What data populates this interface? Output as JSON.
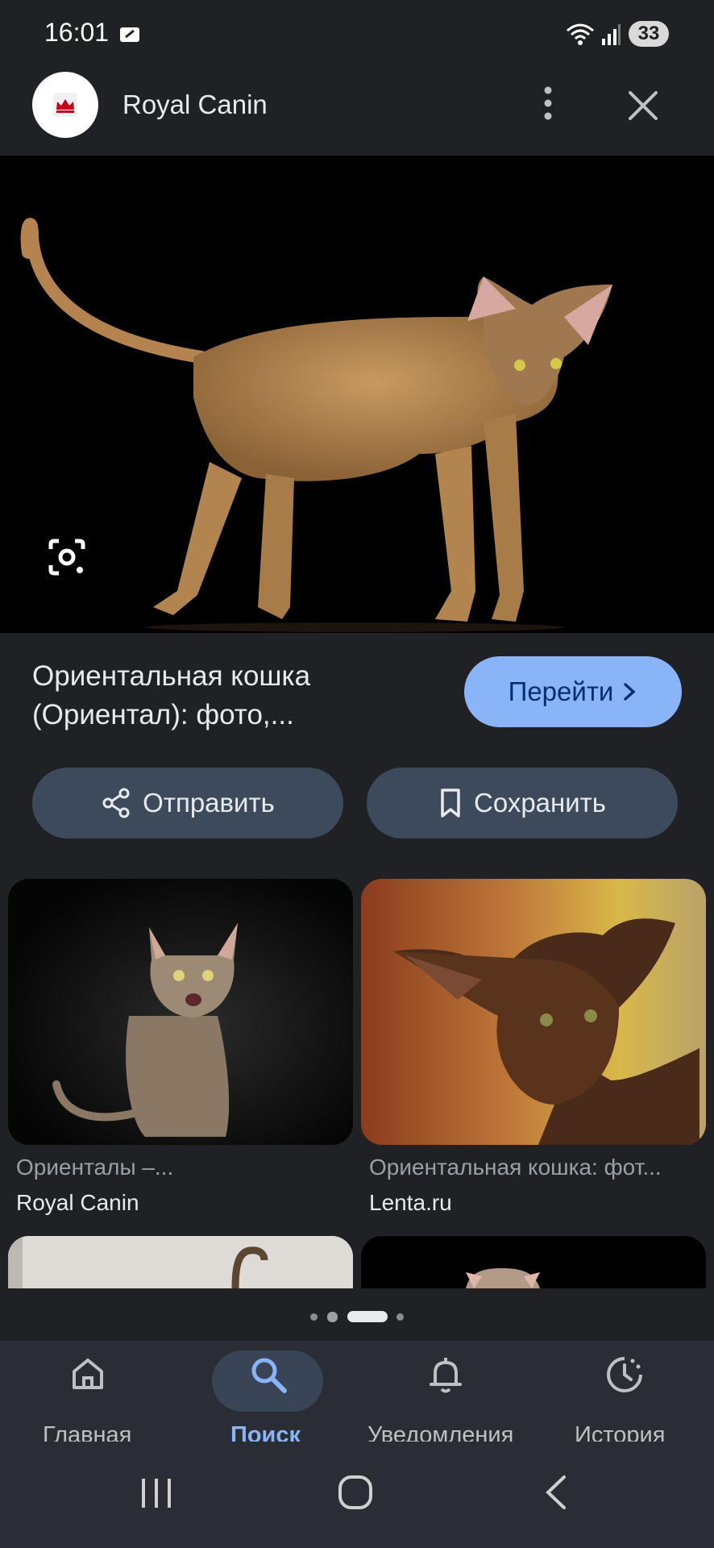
{
  "status": {
    "time": "16:01",
    "battery": "33"
  },
  "header": {
    "site_name": "Royal Canin"
  },
  "result": {
    "title": "Ориентальная кошка (Ориентал): фото,...",
    "visit_label": "Перейти"
  },
  "actions": {
    "share_label": "Отправить",
    "save_label": "Сохранить"
  },
  "related": [
    {
      "title": "Ориенталы –...",
      "source": "Royal Canin"
    },
    {
      "title": "Ориентальная кошка: фот...",
      "source": "Lenta.ru"
    }
  ],
  "pagination": {
    "active_index": 2,
    "count": 4
  },
  "bottom_nav": [
    {
      "label": "Главная",
      "icon": "home-icon"
    },
    {
      "label": "Поиск",
      "icon": "search-icon",
      "active": true
    },
    {
      "label": "Уведомления",
      "icon": "bell-icon"
    },
    {
      "label": "История",
      "icon": "history-icon"
    }
  ],
  "colors": {
    "background": "#202124",
    "accent": "#8ab4f8",
    "active_text": "#8ab4f8",
    "pill_bg": "#3c4a5c"
  }
}
